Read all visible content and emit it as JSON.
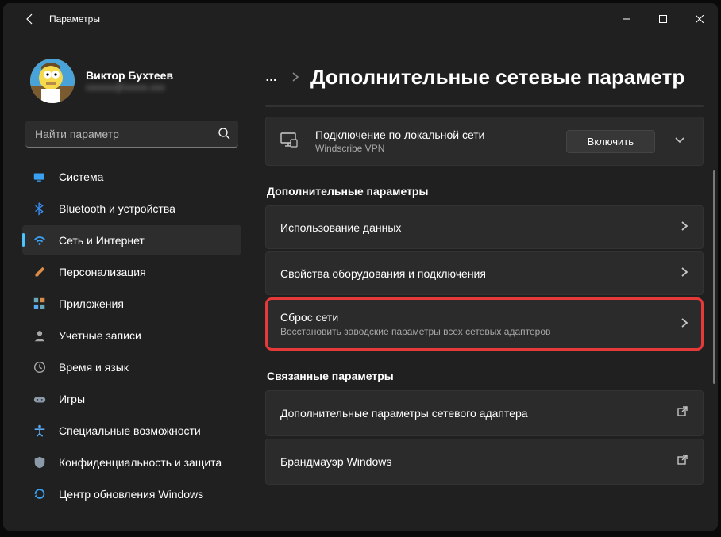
{
  "window": {
    "title": "Параметры"
  },
  "profile": {
    "name": "Виктор Бухтеев",
    "email": "xxxxxx@xxxxx.xxx"
  },
  "search": {
    "placeholder": "Найти параметр"
  },
  "sidebar": {
    "items": [
      {
        "label": "Система",
        "icon": "system",
        "color": "#3aa0f2"
      },
      {
        "label": "Bluetooth и устройства",
        "icon": "bluetooth",
        "color": "#3a8ff2"
      },
      {
        "label": "Сеть и Интернет",
        "icon": "wifi",
        "color": "#3aa0f2"
      },
      {
        "label": "Персонализация",
        "icon": "brush",
        "color": "#d98b48"
      },
      {
        "label": "Приложения",
        "icon": "apps",
        "color": "#6aa7b8"
      },
      {
        "label": "Учетные записи",
        "icon": "account",
        "color": "#a8a8a8"
      },
      {
        "label": "Время и язык",
        "icon": "clock",
        "color": "#a8a8a8"
      },
      {
        "label": "Игры",
        "icon": "games",
        "color": "#8a9aa8"
      },
      {
        "label": "Специальные возможности",
        "icon": "accessibility",
        "color": "#5aa8f2"
      },
      {
        "label": "Конфиденциальность и защита",
        "icon": "shield",
        "color": "#8a9aa8"
      },
      {
        "label": "Центр обновления Windows",
        "icon": "update",
        "color": "#3aa0f2"
      }
    ],
    "active_index": 2
  },
  "breadcrumb": {
    "ellipsis": "…",
    "current": "Дополнительные сетевые параметр"
  },
  "connection_card": {
    "title": "Подключение по локальной сети",
    "subtitle": "Windscribe VPN",
    "button": "Включить"
  },
  "sections": [
    {
      "label": "Дополнительные параметры",
      "rows": [
        {
          "title": "Использование данных",
          "action": "chevron"
        },
        {
          "title": "Свойства оборудования и подключения",
          "action": "chevron"
        },
        {
          "title": "Сброс сети",
          "subtitle": "Восстановить заводские параметры всех сетевых адаптеров",
          "action": "chevron",
          "highlighted": true
        }
      ]
    },
    {
      "label": "Связанные параметры",
      "rows": [
        {
          "title": "Дополнительные параметры сетевого адаптера",
          "action": "external"
        },
        {
          "title": "Брандмауэр Windows",
          "action": "external"
        }
      ]
    }
  ]
}
